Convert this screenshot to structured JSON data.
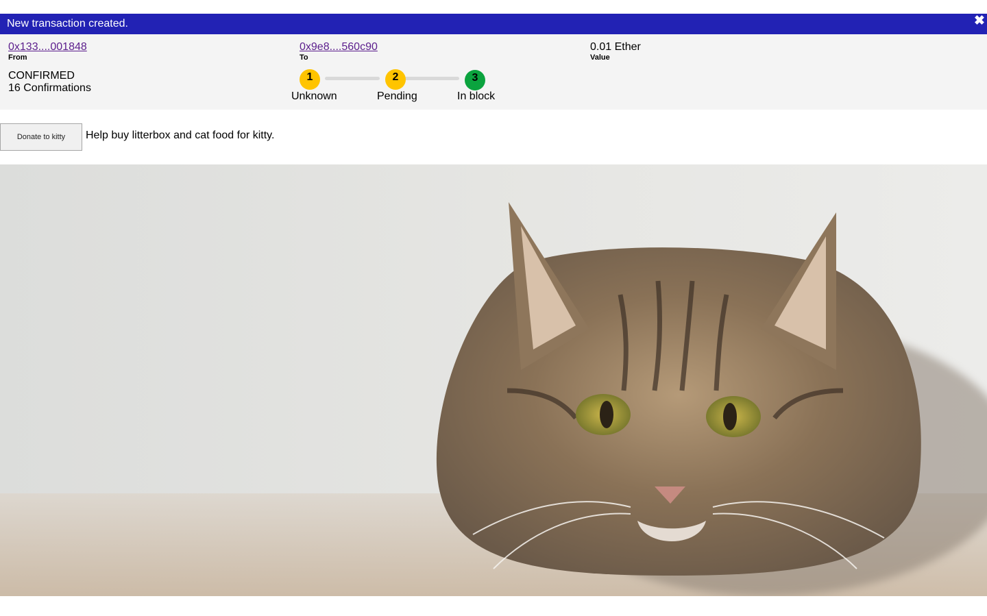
{
  "notification": {
    "message": "New transaction created.",
    "close_icon": "close-icon",
    "close_glyph": "✖",
    "colors": {
      "background": "#2222b4",
      "text": "#ffffff"
    }
  },
  "transaction": {
    "from": {
      "address": "0x133....001848",
      "label": "From"
    },
    "to": {
      "address": "0x9e8....560c90",
      "label": "To"
    },
    "value": {
      "amount": "0.01 Ether",
      "label": "Value"
    },
    "status": "CONFIRMED",
    "confirmations": "16 Confirmations",
    "steps": [
      {
        "number": "1",
        "label": "Unknown",
        "color": "#ffc400"
      },
      {
        "number": "2",
        "label": "Pending",
        "color": "#ffc400"
      },
      {
        "number": "3",
        "label": "In block",
        "color": "#0ba33e"
      }
    ],
    "colors": {
      "panel": "#f4f4f4",
      "link": "#5b1d8c",
      "progress_track": "#d9d9d9"
    }
  },
  "donation": {
    "button_label": "Donate to kitty",
    "description": "Help buy litterbox and cat food for kitty."
  },
  "hero_image": {
    "subject": "tabby-cat-photo"
  }
}
